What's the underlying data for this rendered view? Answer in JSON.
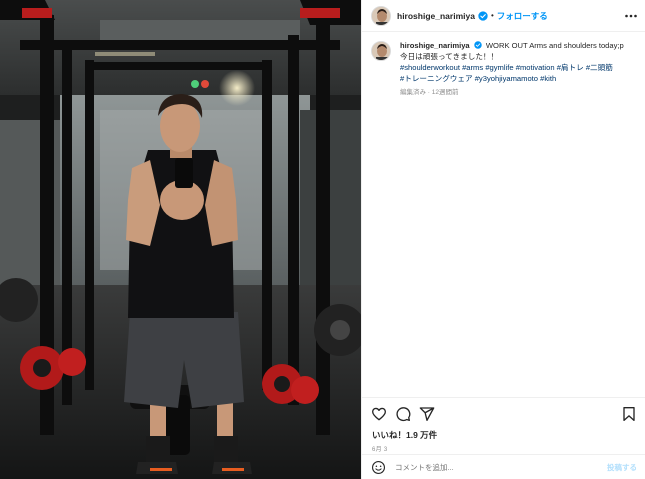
{
  "post": {
    "username": "hiroshige_narimiya",
    "follow_label": "フォローする",
    "separator": "•",
    "caption_text": "WORK OUT Arms and shoulders today;p",
    "caption_line2": "今日は頑張ってきました！！",
    "hashtags_line1": [
      "#shoulderworkout",
      "#arms",
      "#gymlife",
      "#motivation",
      "#肩トレ",
      "#二頭筋"
    ],
    "hashtags_line2": [
      "#トレーニングウェア",
      "#y3yohjiyamamoto",
      "#kith"
    ],
    "caption_meta": "編集済み · 12週間前",
    "likes": "いいね！1.9 万件",
    "date": "6月 3",
    "comment_placeholder": "コメントを追加...",
    "post_button": "投稿する"
  },
  "icons": {
    "more": "more-options-icon",
    "like": "heart-icon",
    "comment": "comment-icon",
    "share": "share-icon",
    "save": "bookmark-icon",
    "emoji": "emoji-icon",
    "verified": "verified-badge-icon"
  },
  "colors": {
    "accent": "#0095f6",
    "hashtag": "#00376b",
    "muted": "#8e8e8e",
    "post_disabled": "#b2dffc"
  }
}
